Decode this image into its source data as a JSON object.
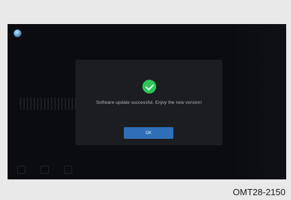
{
  "dialog": {
    "message": "Software update successful. Enjoy the new version!",
    "ok_label": "OK"
  },
  "caption": "OMT28-2150",
  "colors": {
    "accent": "#2f6fb8",
    "success": "#2cc45b"
  }
}
